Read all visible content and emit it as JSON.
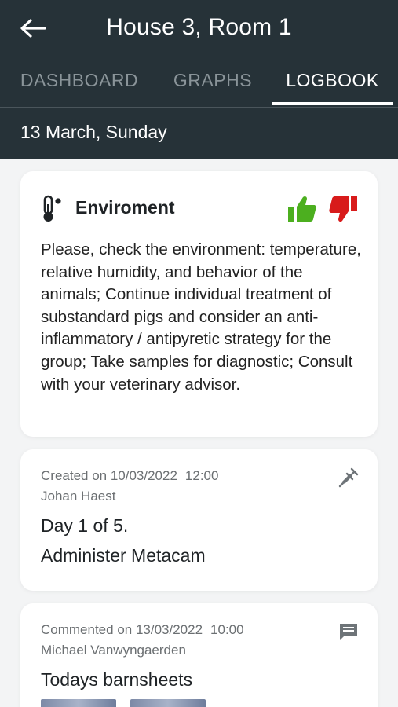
{
  "header": {
    "title": "House 3, Room 1",
    "tabs": [
      {
        "label": "DASHBOARD",
        "active": false
      },
      {
        "label": "GRAPHS",
        "active": false
      },
      {
        "label": "LOGBOOK",
        "active": true
      }
    ],
    "date": "13 March, Sunday",
    "colors": {
      "bar": "#263238",
      "tab_inactive": "#8a9499"
    }
  },
  "advice": {
    "icon": "thermometer-icon",
    "title": "Enviroment",
    "body": "Please, check the environment: temperature, relative humidity, and behavior of the animals; Continue individual treatment of substandard pigs and consider an anti-inflammatory / antipyretic strategy for the group; Take samples for diagnostic; Consult with your veterinary advisor.",
    "like_color": "#4caf1f",
    "dislike_color": "#d81b1b"
  },
  "entries": [
    {
      "type": "treatment",
      "icon": "syringe-icon",
      "meta_label": "Created on 10/03/2022",
      "time": "12:00",
      "author": "Johan Haest",
      "line1": "Day 1 of 5.",
      "line2": "Administer Metacam"
    },
    {
      "type": "comment",
      "icon": "comment-icon",
      "meta_label": "Commented on 13/03/2022",
      "time": "10:00",
      "author": "Michael Vanwyngaerden",
      "line1": "Todays barnsheets"
    }
  ]
}
